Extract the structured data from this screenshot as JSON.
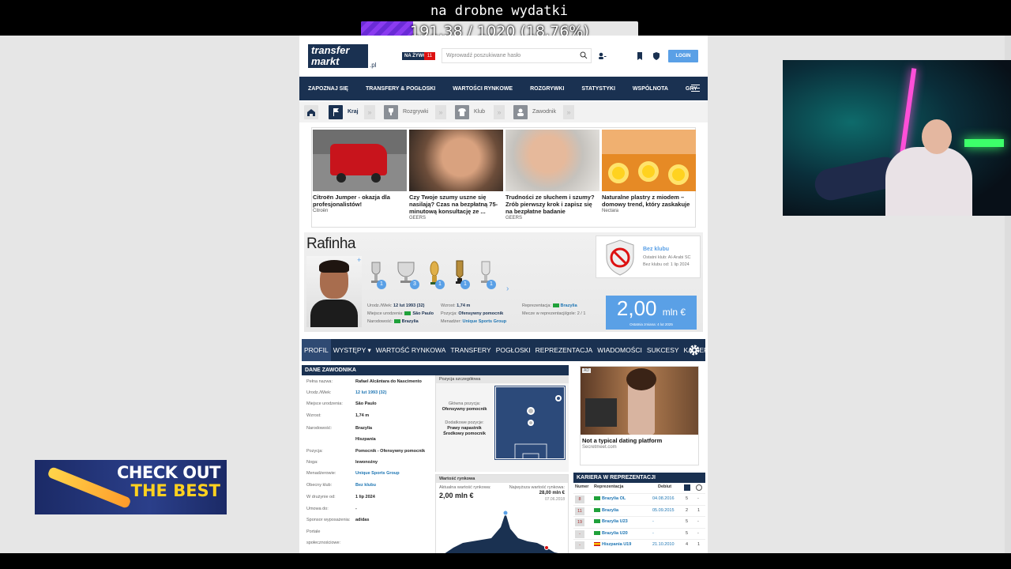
{
  "overlay": {
    "title": "na drobne wydatki",
    "donation_text": "191.38 / 1020 (18.76%)",
    "donation_progress": 0.1876,
    "accent": "#7b32e6"
  },
  "ad_banner": {
    "line1": "CHECK OUT",
    "line2": "THE BEST"
  },
  "header": {
    "logo_line1": "transfer",
    "logo_line2": "markt",
    "logo_suffix": ".pl",
    "live_label": "NA ŻYWO",
    "live_count": "11",
    "search_placeholder": "Wprowadź poszukiwane hasło",
    "login_label": "LOGIN"
  },
  "nav": {
    "items": [
      "ZAPOZNAJ SIĘ",
      "TRANSFERY & POGŁOSKI",
      "WARTOŚCI RYNKOWE",
      "ROZGRYWKI",
      "STATYSTYKI",
      "WSPÓLNOTA",
      "GRY"
    ]
  },
  "breadcrumbs": {
    "country": "Kraj",
    "competitions": "Rozgrywki",
    "club": "Klub",
    "player": "Zawodnik"
  },
  "ads": [
    {
      "text": "Citroën Jumper - okazja dla profesjonalistów!",
      "source": "Citroën"
    },
    {
      "text": "Czy Twoje szumy uszne się nasilają? Czas na bezpłatną 75-minutową konsultację ze ...",
      "source": "GEERS"
    },
    {
      "text": "Trudności ze słuchem i szumy? Zrób pierwszy krok i zapisz się na bezpłatne badanie",
      "source": "GEERS"
    },
    {
      "text": "Naturalne plastry z miodem – domowy trend, który zaskakuje",
      "source": "Nectara"
    }
  ],
  "player": {
    "name": "Rafinha",
    "trophy_counts": [
      "1",
      "3",
      "1",
      "1",
      "1"
    ],
    "info": {
      "birth_label": "Urodz./Wiek:",
      "birth_value": "12 lut 1993 (32)",
      "place_label": "Miejsce urodzenia:",
      "place_value": "São Paulo",
      "nationality_label": "Narodowość:",
      "nationality_value": "Brazylia",
      "height_label": "Wzrost:",
      "height_value": "1,74 m",
      "position_label": "Pozycja:",
      "position_value": "Ofensywny pomocnik",
      "agent_label": "Menadżer:",
      "agent_value": "Unique Sports Group",
      "national_label": "Reprezentacja:",
      "national_value": "Brazylia",
      "caps_label": "Mecze w reprezentacji/gole:",
      "caps_value": "2 / 1"
    },
    "club": {
      "title": "Bez klubu",
      "last_club": "Ostatni klub: Al-Arabi SC",
      "since": "Bez klubu od: 1 lip 2024"
    },
    "market_value": "2,00",
    "market_unit": "mln €",
    "market_date": "Ostatnia zmiana: 4 lut 2025"
  },
  "subnav": {
    "items": [
      "PROFIL",
      "WYSTĘPY ▾",
      "WARTOŚĆ RYNKOWA",
      "TRANSFERY",
      "POGŁOSKI",
      "REPREZENTACJA",
      "WIADOMOŚCI",
      "SUKCESY",
      "KARIERA ▾"
    ]
  },
  "dane": {
    "title": "DANE ZAWODNIKA",
    "rows": [
      {
        "label": "Pełna nazwa:",
        "value": "Rafael Alcântara do Nascimento"
      },
      {
        "label": "Urodz./Wiek:",
        "value": "12 lut 1993 (32)"
      },
      {
        "label": "Miejsce urodzenia:",
        "value": "São Paulo"
      },
      {
        "label": "Wzrost:",
        "value": "1,74 m"
      },
      {
        "label": "Narodowość:",
        "value": "Brazylia"
      },
      {
        "label": "",
        "value": "Hiszpania"
      },
      {
        "label": "Pozycja:",
        "value": "Pomocnik - Ofensywny pomocnik"
      },
      {
        "label": "Noga:",
        "value": "lewonożny"
      },
      {
        "label": "Menadżerowie:",
        "value": "Unique Sports Group"
      },
      {
        "label": "Obecny klub:",
        "value": "Bez klubu"
      },
      {
        "label": "W drużynie od:",
        "value": "1 lip 2024"
      },
      {
        "label": "Umowa do:",
        "value": "-"
      },
      {
        "label": "Sponsor wyposażenia:",
        "value": "adidas"
      },
      {
        "label": "Portale",
        "value": ""
      },
      {
        "label": "społecznościowe:",
        "value": ""
      }
    ],
    "position_title": "Pozycja szczegółowa",
    "main_position_label": "Główna pozycja:",
    "main_position": "Ofensywny pomocnik",
    "other_positions_label": "Dodatkowe pozycje:",
    "other_position_1": "Prawy napastnik",
    "other_position_2": "Środkowy pomocnik",
    "mv_title": "Wartość rynkowa",
    "mv_current_label": "Aktualna wartość rynkowa:",
    "mv_current": "2,00 mln €",
    "mv_max_label": "Najwyższa wartość rynkowa:",
    "mv_max": "28,00 mln €",
    "mv_max_date": "07.06.2018"
  },
  "right_ad": {
    "label": "AD",
    "title": "Not a typical dating platform",
    "source": "Secretmeet.com"
  },
  "kariera": {
    "title": "KARIERA W REPREZENTACJI",
    "col_number": "Numer",
    "col_team": "Reprezentacja",
    "col_debut": "Debiut",
    "rows": [
      {
        "num": "8",
        "team": "Brazylia OL",
        "flag": "br",
        "debut": "04.08.2016",
        "g": "5",
        "a": "-"
      },
      {
        "num": "11",
        "team": "Brazylia",
        "flag": "br",
        "debut": "05.09.2015",
        "g": "2",
        "a": "1"
      },
      {
        "num": "19",
        "team": "Brazylia U23",
        "flag": "br",
        "debut": "-",
        "g": "5",
        "a": "-"
      },
      {
        "num": "-",
        "team": "Brazylia U20",
        "flag": "br",
        "debut": "-",
        "g": "5",
        "a": "-"
      },
      {
        "num": "-",
        "team": "Hiszpania U19",
        "flag": "es",
        "debut": "21.10.2010",
        "g": "4",
        "a": "1"
      }
    ]
  }
}
